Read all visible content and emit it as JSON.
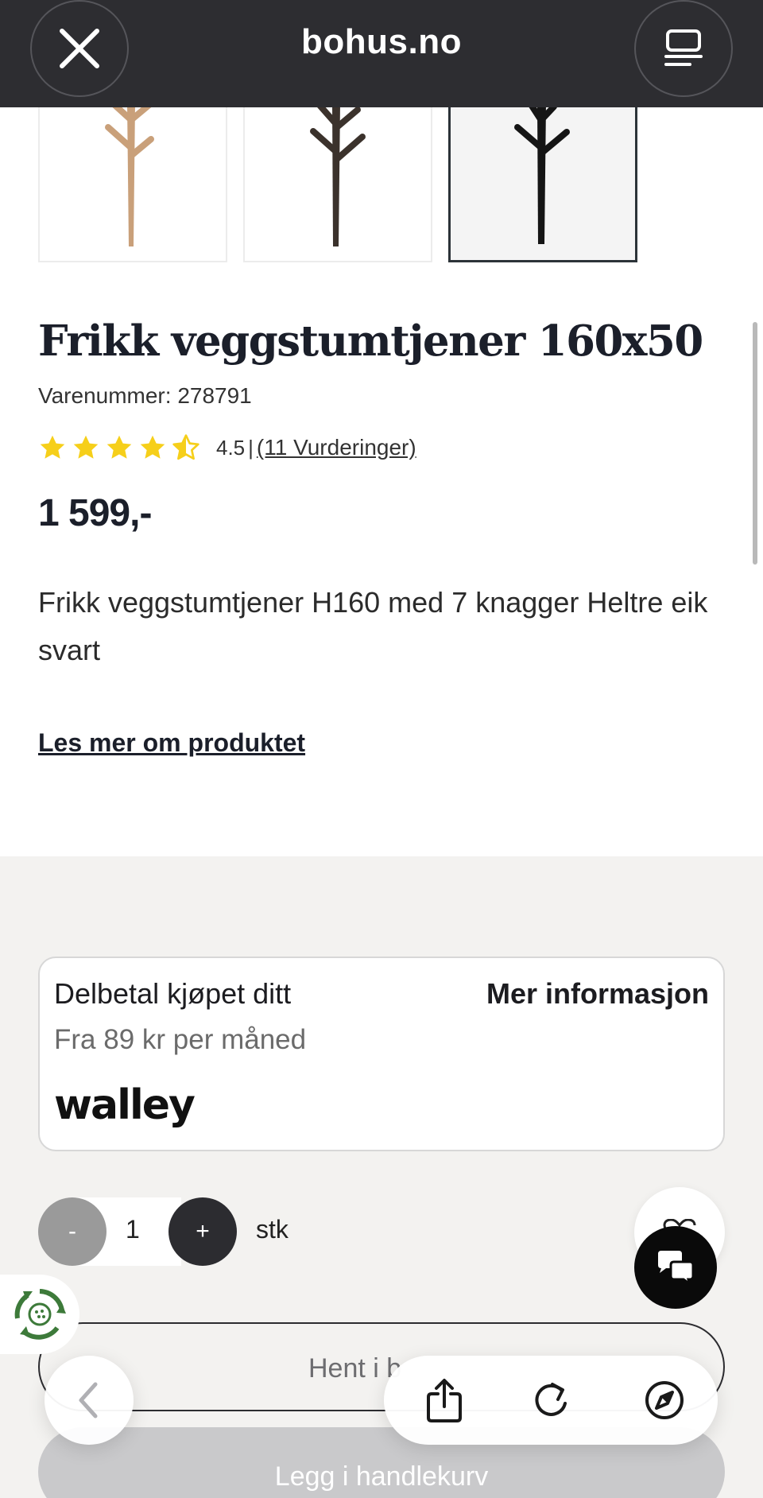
{
  "browser": {
    "domain": "bohus.no",
    "close_icon": "close-icon",
    "tabs_icon": "tabs-icon"
  },
  "gallery": {
    "thumbnails": [
      {
        "variant": "natural oak",
        "color": "#c9a07a"
      },
      {
        "variant": "dark brown",
        "color": "#3b322c"
      },
      {
        "variant": "black",
        "color": "#151515",
        "selected": true
      }
    ]
  },
  "product": {
    "title": "Frikk veggstumtjener 160x50",
    "sku": "Varenummer: 278791",
    "rating": {
      "value": "4.5",
      "separator": "|",
      "reviews_link": "(11 Vurderinger)",
      "stars": 4.5,
      "star_color": "#f6cf1a"
    },
    "price": "1 599,-",
    "description": "Frikk veggstumtjener H160 med 7 knagger Heltre eik svart",
    "read_more": "Les mer om produktet"
  },
  "payment": {
    "title": "Delbetal kjøpet ditt",
    "more_info": "Mer informasjon",
    "subtitle": "Fra 89 kr per måned",
    "provider_logo": "walley"
  },
  "quantity": {
    "minus": "-",
    "value": "1",
    "plus": "+",
    "unit": "stk"
  },
  "actions": {
    "pickup_label": "Hent i b",
    "add_to_cart_label": "Legg i handlekurv"
  },
  "floating": {
    "heart_icon": "heart-icon",
    "chat_icon": "chat-icon",
    "recycle_icon": "recycle-icon"
  },
  "toolbar": {
    "back_icon": "chevron-left-icon",
    "share_icon": "share-icon",
    "reload_icon": "reload-icon",
    "compass_icon": "compass-icon"
  },
  "colors": {
    "topbar": "#2d2d31",
    "accent_dark": "#2c2c30",
    "lower_bg": "#f3f2f0",
    "star": "#f6cf1a"
  }
}
